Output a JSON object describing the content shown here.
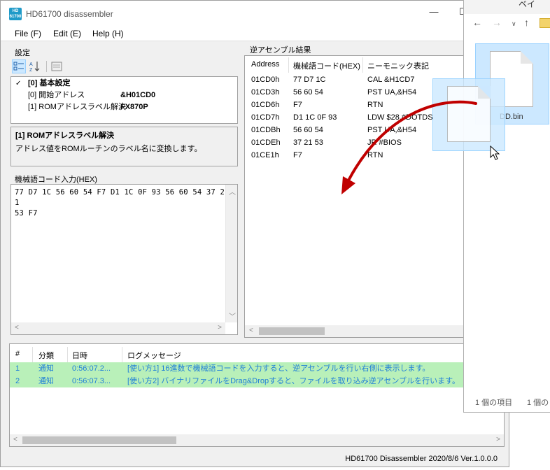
{
  "window": {
    "icon_text": "HD 61700",
    "title": "HD61700 disassembler",
    "minimize": "—",
    "maximize": "☐"
  },
  "menu": [
    "File (F)",
    "Edit (E)",
    "Help (H)"
  ],
  "settings": {
    "label": "設定",
    "category": "[0] 基本設定",
    "properties": [
      {
        "name": "[0] 開始アドレス",
        "value": "&H01CD0"
      },
      {
        "name": "[1] ROMアドレスラベル解決",
        "value": "FX870P"
      }
    ],
    "description_title": "[1] ROMアドレスラベル解決",
    "description_text": "アドレス値をROMルーチンのラベル名に変換します。"
  },
  "code_input": {
    "label": "機械語コード入力(HEX)",
    "value": "77 D7 1C 56 60 54 F7 D1 1C 0F 93 56 60 54 37 21\n53 F7"
  },
  "disassembly": {
    "label": "逆アセンブル結果",
    "columns": [
      "Address",
      "機械語コード(HEX)",
      "ニーモニック表記"
    ],
    "rows": [
      {
        "address": "01CD0h",
        "hex": "77 D7 1C",
        "mnemonic": "CAL &H1CD7"
      },
      {
        "address": "01CD3h",
        "hex": "56 60 54",
        "mnemonic": "PST UA,&H54"
      },
      {
        "address": "01CD6h",
        "hex": "F7",
        "mnemonic": "RTN"
      },
      {
        "address": "01CD7h",
        "hex": "D1 1C 0F 93",
        "mnemonic": "LDW $28,#DOTDS"
      },
      {
        "address": "01CDBh",
        "hex": "56 60 54",
        "mnemonic": "PST UA,&H54"
      },
      {
        "address": "01CDEh",
        "hex": "37 21 53",
        "mnemonic": "JR #BIOS"
      },
      {
        "address": "01CE1h",
        "hex": "F7",
        "mnemonic": "RTN"
      }
    ]
  },
  "log": {
    "columns": [
      "#",
      "分類",
      "日時",
      "ログメッセージ"
    ],
    "rows": [
      {
        "no": "1",
        "category": "通知",
        "time": "0:56:07.2...",
        "message": "[使い方1] 16進数で機械語コードを入力すると、逆アセンブルを行い右側に表示します。"
      },
      {
        "no": "2",
        "category": "通知",
        "time": "0:56:07.3...",
        "message": "[使い方2] バイナリファイルをDrag&Dropすると、ファイルを取り込み逆アセンブルを行います。"
      }
    ]
  },
  "status": "HD61700 Disassembler 2020/8/6 Ver.1.0.0.0",
  "explorer": {
    "title_partial": "ベイ",
    "file_name": "DD.bin",
    "item_count": "1 個の項目",
    "selected_partial": "1 個の"
  },
  "colors": {
    "log_row_bg": "#b9f0b9",
    "log_row_text": "#1f7fd8",
    "selection_bg": "#cce8ff",
    "drag_arrow": "#c00000"
  }
}
